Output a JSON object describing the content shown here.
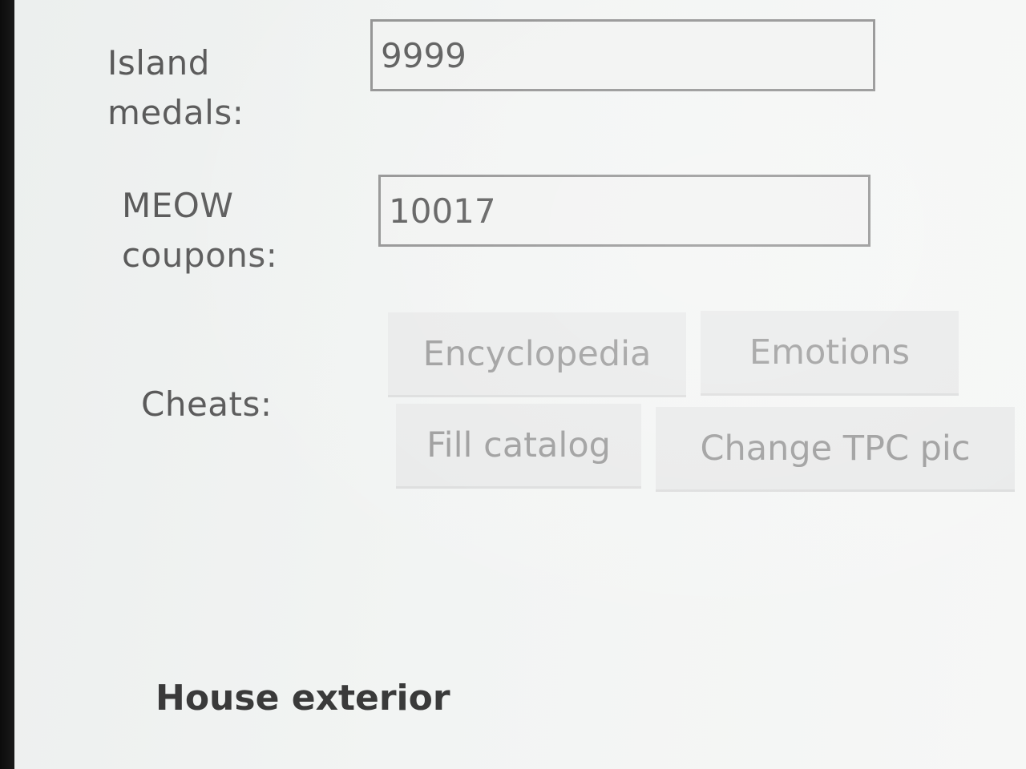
{
  "form": {
    "island_medals": {
      "label_line1": "Island",
      "label_line2": "medals:",
      "value": "9999"
    },
    "meow_coupons": {
      "label_line1": "MEOW",
      "label_line2": "coupons:",
      "value": "10017"
    }
  },
  "cheats": {
    "label": "Cheats:",
    "buttons": [
      {
        "label": "Encyclopedia"
      },
      {
        "label": "Emotions"
      },
      {
        "label": "Fill catalog"
      },
      {
        "label": "Change TPC pic"
      }
    ]
  },
  "section": {
    "house_exterior": "House exterior"
  }
}
